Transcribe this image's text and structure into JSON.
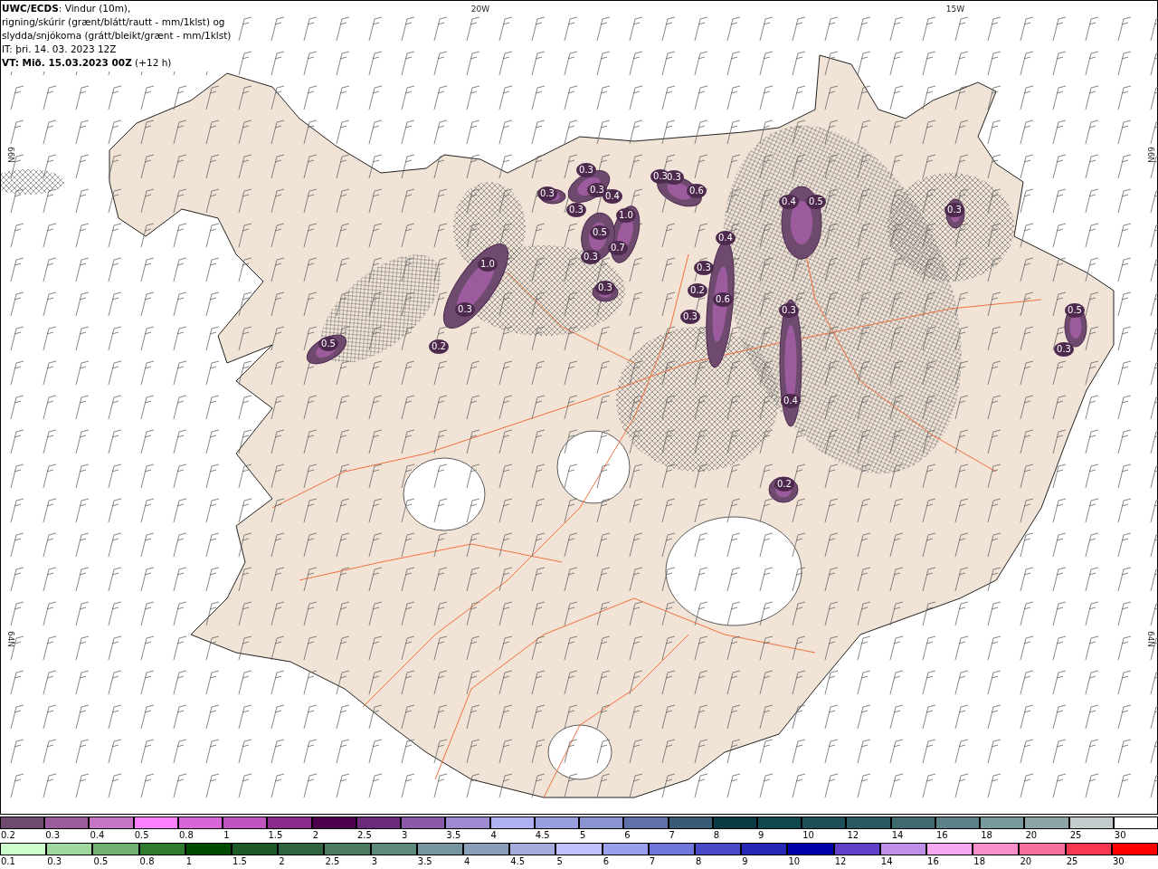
{
  "title_lines": [
    "**UWC/ECDS**: Vindur (10m),",
    "rigning/skúrir (grænt/blátt/rautt - mm/1klst) og",
    "slydda/snjókoma (grátt/bleikt/grænt - mm/1klst)",
    "IT: þri. 14. 03. 2023 12Z",
    "**VT: Mið. 15.03.2023 00Z** (+12 h)"
  ],
  "grid_labels": [
    "20W",
    "15W",
    "66N",
    "66N",
    "64N",
    "64N"
  ],
  "precip_labels": [
    "0.3",
    "0.3",
    "0.3",
    "0.4",
    "0.3",
    "0.3",
    "0.6",
    "0.3",
    "1.0",
    "0.5",
    "0.7",
    "0.4",
    "0.3",
    "0.4",
    "0.5",
    "0.3",
    "1.0",
    "0.3",
    "0.3",
    "0.2",
    "0.6",
    "0.3",
    "0.3",
    "0.5",
    "0.3",
    "0.5",
    "0.3",
    "0.2",
    "0.4",
    "0.2"
  ],
  "legend_rows": [
    {
      "kind": "snow",
      "items": [
        {
          "label": "0.2",
          "color": "#6e4a6e"
        },
        {
          "label": "0.3",
          "color": "#9c5b9c"
        },
        {
          "label": "0.4",
          "color": "#c575c5"
        },
        {
          "label": "0.5",
          "color": "#ff80ff"
        },
        {
          "label": "0.8",
          "color": "#d966d9"
        },
        {
          "label": "1",
          "color": "#c055c0"
        },
        {
          "label": "1.5",
          "color": "#8c2a8c"
        },
        {
          "label": "2",
          "color": "#4d004d"
        },
        {
          "label": "2.5",
          "color": "#6b2a7a"
        },
        {
          "label": "3",
          "color": "#8a5aa8"
        },
        {
          "label": "3.5",
          "color": "#9e8ad0"
        },
        {
          "label": "4",
          "color": "#b0b0f5"
        },
        {
          "label": "4.5",
          "color": "#98a0e0"
        },
        {
          "label": "5",
          "color": "#8a94d0"
        },
        {
          "label": "6",
          "color": "#6070a8"
        },
        {
          "label": "7",
          "color": "#3a5a78"
        },
        {
          "label": "8",
          "color": "#0a3a44"
        },
        {
          "label": "9",
          "color": "#104850"
        },
        {
          "label": "10",
          "color": "#1e4e58"
        },
        {
          "label": "12",
          "color": "#2a5a60"
        },
        {
          "label": "14",
          "color": "#3e6a70"
        },
        {
          "label": "16",
          "color": "#5a8088"
        },
        {
          "label": "18",
          "color": "#789a9e"
        },
        {
          "label": "20",
          "color": "#8ea4a6"
        },
        {
          "label": "25",
          "color": "#c4ccce"
        },
        {
          "label": "30",
          "color": "#ffffff"
        }
      ]
    },
    {
      "kind": "rain",
      "items": [
        {
          "label": "0.1",
          "color": "#ccffcc"
        },
        {
          "label": "0.3",
          "color": "#a0d8a0"
        },
        {
          "label": "0.5",
          "color": "#70b070"
        },
        {
          "label": "0.8",
          "color": "#307a30"
        },
        {
          "label": "1",
          "color": "#004a00"
        },
        {
          "label": "1.5",
          "color": "#1e5a28"
        },
        {
          "label": "2",
          "color": "#2e6440"
        },
        {
          "label": "2.5",
          "color": "#4a7a62"
        },
        {
          "label": "3",
          "color": "#5e8a7e"
        },
        {
          "label": "3.5",
          "color": "#7896a0"
        },
        {
          "label": "4",
          "color": "#8aa0ba"
        },
        {
          "label": "4.5",
          "color": "#a4acdc"
        },
        {
          "label": "5",
          "color": "#c0c0ff"
        },
        {
          "label": "6",
          "color": "#9aa0ee"
        },
        {
          "label": "7",
          "color": "#7076dc"
        },
        {
          "label": "8",
          "color": "#4a4ac8"
        },
        {
          "label": "9",
          "color": "#2828b8"
        },
        {
          "label": "10",
          "color": "#0000aa"
        },
        {
          "label": "12",
          "color": "#6040c8"
        },
        {
          "label": "14",
          "color": "#c090e8"
        },
        {
          "label": "16",
          "color": "#f8a8f0"
        },
        {
          "label": "18",
          "color": "#f890cc"
        },
        {
          "label": "20",
          "color": "#f870a0"
        },
        {
          "label": "25",
          "color": "#f83850"
        },
        {
          "label": "30",
          "color": "#ff0000"
        }
      ]
    }
  ]
}
